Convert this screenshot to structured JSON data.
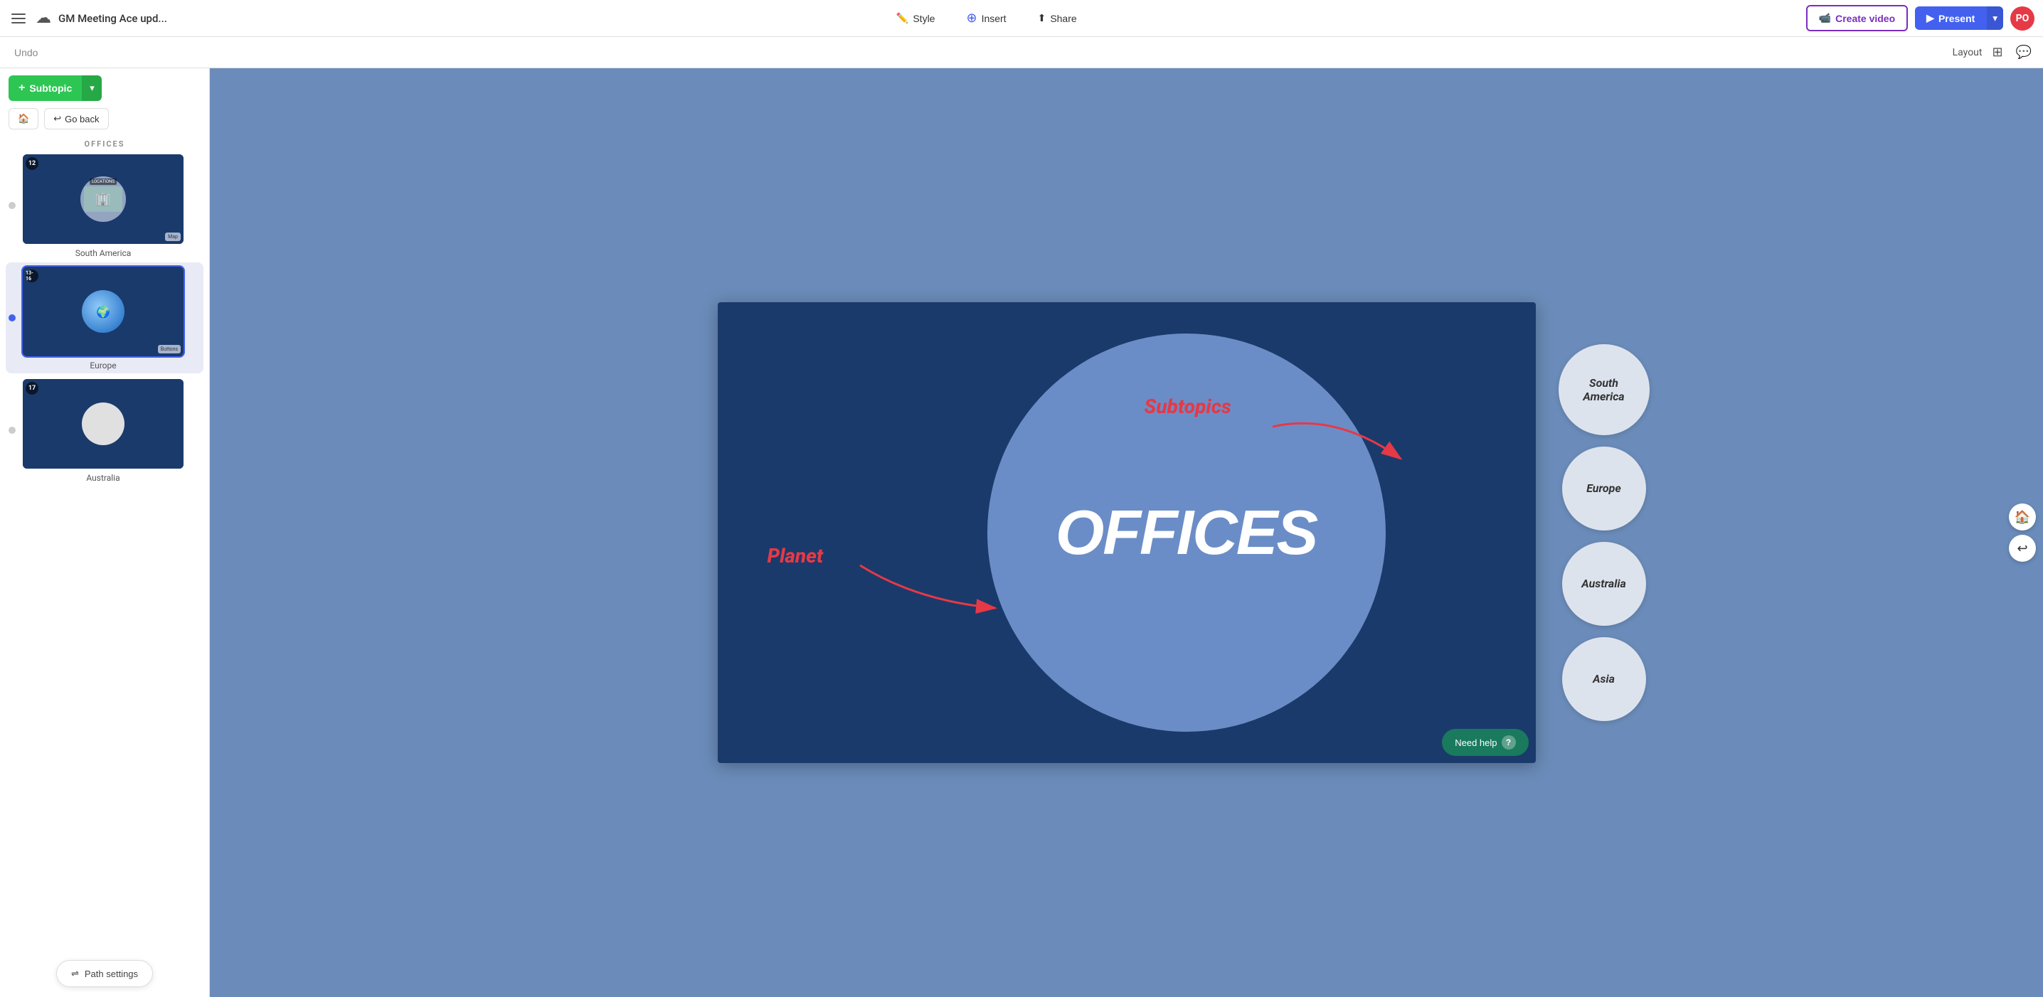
{
  "app": {
    "title": "GM Meeting Ace upd...",
    "hamburger_label": "menu",
    "cloud_icon": "☁"
  },
  "top_nav": {
    "style_label": "Style",
    "insert_label": "Insert",
    "share_label": "Share",
    "style_icon": "✏️",
    "insert_icon": "➕",
    "share_icon": "⬆"
  },
  "top_right": {
    "create_video_label": "Create video",
    "present_label": "Present",
    "avatar_initials": "PO",
    "avatar_color": "#e63946"
  },
  "second_bar": {
    "undo_label": "Undo",
    "layout_label": "Layout"
  },
  "sidebar": {
    "subtopic_label": "Subtopic",
    "home_label": "🏠",
    "go_back_label": "Go back",
    "section_title": "OFFICES",
    "slides": [
      {
        "id": 12,
        "label": "South America",
        "active": false
      },
      {
        "id": "13-16",
        "label": "Europe",
        "active": true
      },
      {
        "id": 17,
        "label": "Australia",
        "active": false
      }
    ],
    "path_settings_label": "Path settings"
  },
  "canvas": {
    "offices_text": "OFFICES",
    "annotation_planet": "Planet",
    "annotation_subtopics": "Subtopics",
    "subtopics": [
      {
        "label": "South America"
      },
      {
        "label": "Europe"
      },
      {
        "label": "Australia"
      },
      {
        "label": "Asia"
      }
    ]
  },
  "help": {
    "label": "Need help",
    "icon": "?"
  }
}
